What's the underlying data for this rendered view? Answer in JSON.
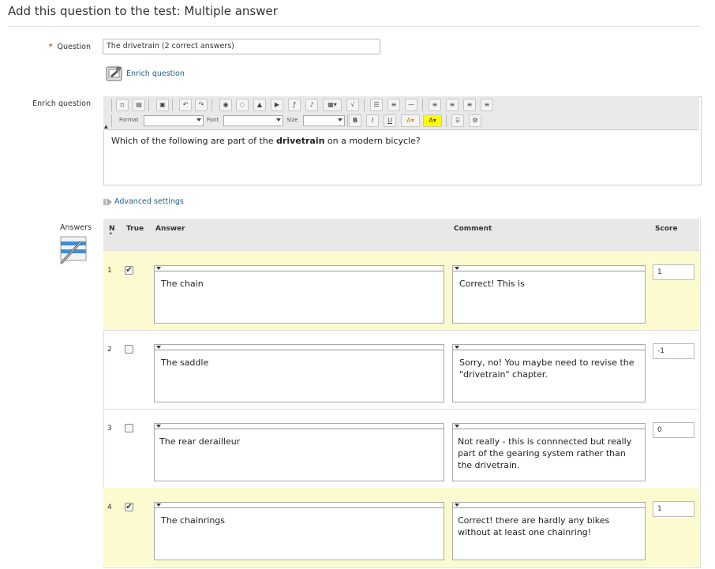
{
  "page": {
    "title": "Add this question to the test: Multiple answer"
  },
  "form": {
    "question_label": "Question",
    "required_mark": "*",
    "question_value": "The drivetrain (2 correct answers)",
    "enrich_link": "Enrich question",
    "enrich_label": "Enrich question",
    "editor": {
      "format_label": "Format",
      "font_label": "Font",
      "size_label": "Size",
      "content_pre": "Which of the following are part of the ",
      "content_bold": "drivetrain",
      "content_post": " on a modern bicycle?"
    },
    "advanced_link": "Advanced settings",
    "answers_label": "Answers"
  },
  "table": {
    "headers": {
      "n": "N",
      "n_sub": "°",
      "true": "True",
      "answer": "Answer",
      "comment": "Comment",
      "score": "Score"
    },
    "rows": [
      {
        "n": "1",
        "checked": true,
        "answer": "The chain",
        "comment": "Correct! This is",
        "score": "1"
      },
      {
        "n": "2",
        "checked": false,
        "answer": "The saddle",
        "comment": "Sorry, no! You maybe need to revise the \"drivetrain\" chapter.",
        "score": "-1"
      },
      {
        "n": "3",
        "checked": false,
        "answer": "The rear derailleur",
        "comment": "Not really - this is connnected but really part of the gearing system rather than the drivetrain.",
        "score": "0"
      },
      {
        "n": "4",
        "checked": true,
        "answer": "The chainrings",
        "comment": "Correct! there are hardly any bikes without at least one chainring!",
        "score": "1"
      }
    ]
  },
  "colors": {
    "link": "#1f5f8f",
    "row_highlight": "#fbfbcf",
    "required": "#cc0000"
  }
}
